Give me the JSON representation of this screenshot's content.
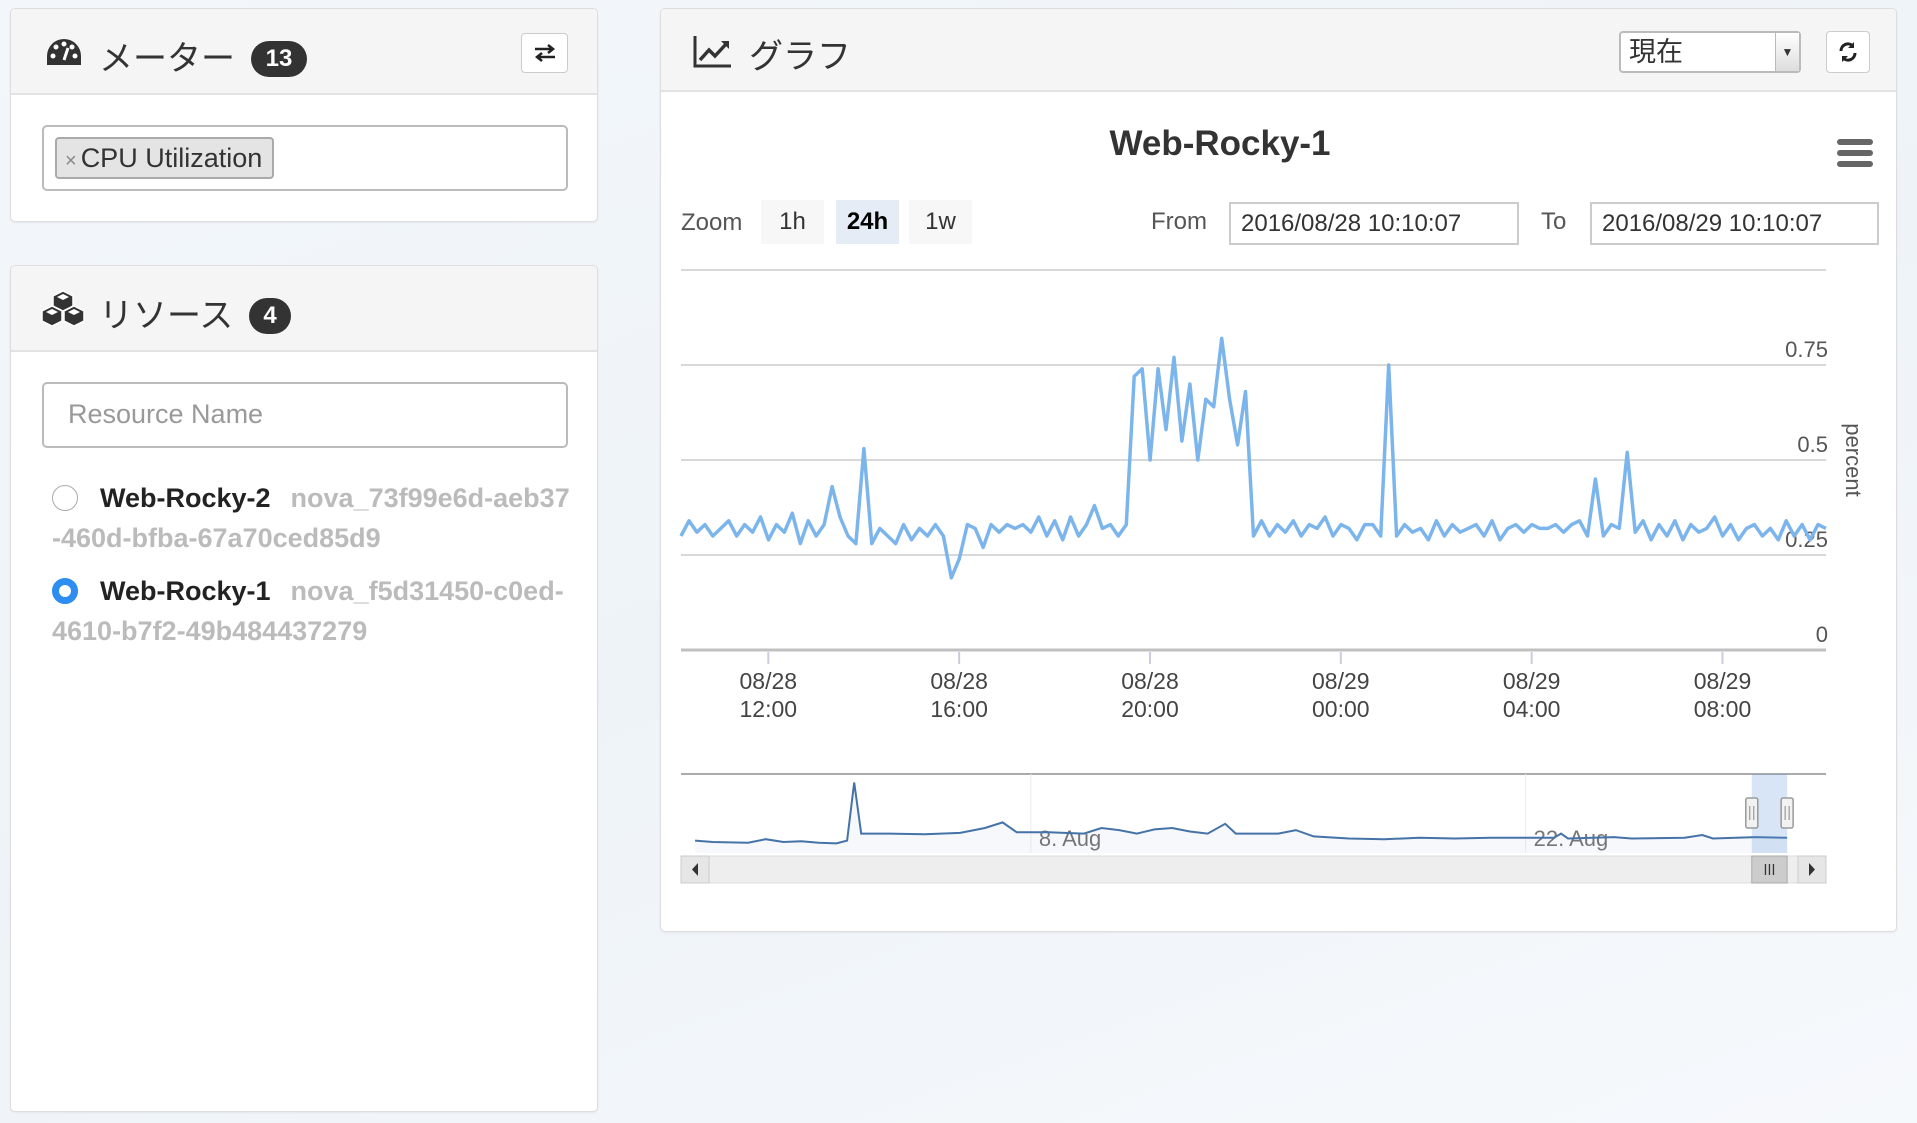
{
  "meters": {
    "title": "メーター",
    "count": "13",
    "selected_tag": "CPU Utilization",
    "tag_remove": "×"
  },
  "resources": {
    "title": "リソース",
    "count": "4",
    "search_placeholder": "Resource Name",
    "items": [
      {
        "name": "Web-Rocky-2",
        "id": "nova_73f99e6d-aeb37-460d-bfba-67a70ced85d9",
        "selected": false
      },
      {
        "name": "Web-Rocky-1",
        "id": "nova_f5d31450-c0ed-4610-b7f2-49b484437279",
        "selected": true
      }
    ]
  },
  "graph": {
    "title": "グラフ",
    "period_select": "現在",
    "zoom_label": "Zoom",
    "zoom_options": [
      "1h",
      "24h",
      "1w"
    ],
    "zoom_selected": "24h",
    "from_label": "From",
    "from_value": "2016/08/28 10:10:07",
    "to_label": "To",
    "to_value": "2016/08/29 10:10:07"
  },
  "colors": {
    "series": "#7cb5ec",
    "navigator": "#4572a7",
    "selected_radio": "#2e8df0"
  },
  "chart_data": {
    "type": "line",
    "title": "Web-Rocky-1",
    "ylabel": "percent",
    "ylim": [
      0,
      1
    ],
    "yticks": [
      "0",
      "0.25",
      "0.5",
      "0.75"
    ],
    "ytick_values": [
      0,
      0.25,
      0.5,
      0.75
    ],
    "x_start": "2016/08/28 10:10:07",
    "x_end": "2016/08/29 10:10:07",
    "x_step_minutes": 10,
    "xticks": [
      {
        "l1": "08/28",
        "l2": "12:00",
        "hours": 1.83
      },
      {
        "l1": "08/28",
        "l2": "16:00",
        "hours": 5.83
      },
      {
        "l1": "08/28",
        "l2": "20:00",
        "hours": 9.83
      },
      {
        "l1": "08/29",
        "l2": "00:00",
        "hours": 13.83
      },
      {
        "l1": "08/29",
        "l2": "04:00",
        "hours": 17.83
      },
      {
        "l1": "08/29",
        "l2": "08:00",
        "hours": 21.83
      }
    ],
    "series": [
      {
        "name": "CPU Utilization",
        "values": [
          0.3,
          0.34,
          0.31,
          0.33,
          0.3,
          0.32,
          0.34,
          0.3,
          0.33,
          0.31,
          0.35,
          0.29,
          0.33,
          0.31,
          0.36,
          0.28,
          0.34,
          0.3,
          0.33,
          0.43,
          0.35,
          0.3,
          0.28,
          0.53,
          0.28,
          0.32,
          0.3,
          0.28,
          0.33,
          0.29,
          0.32,
          0.3,
          0.33,
          0.3,
          0.19,
          0.24,
          0.33,
          0.32,
          0.27,
          0.33,
          0.31,
          0.33,
          0.32,
          0.33,
          0.31,
          0.35,
          0.3,
          0.34,
          0.29,
          0.35,
          0.3,
          0.33,
          0.38,
          0.32,
          0.33,
          0.3,
          0.33,
          0.72,
          0.74,
          0.5,
          0.74,
          0.58,
          0.77,
          0.55,
          0.7,
          0.5,
          0.66,
          0.64,
          0.82,
          0.66,
          0.54,
          0.68,
          0.3,
          0.34,
          0.3,
          0.33,
          0.31,
          0.34,
          0.3,
          0.33,
          0.32,
          0.35,
          0.3,
          0.33,
          0.32,
          0.29,
          0.33,
          0.33,
          0.3,
          0.75,
          0.3,
          0.33,
          0.31,
          0.32,
          0.29,
          0.34,
          0.3,
          0.33,
          0.31,
          0.32,
          0.33,
          0.3,
          0.34,
          0.29,
          0.32,
          0.33,
          0.31,
          0.33,
          0.32,
          0.32,
          0.33,
          0.31,
          0.33,
          0.34,
          0.3,
          0.45,
          0.3,
          0.33,
          0.32,
          0.52,
          0.31,
          0.34,
          0.29,
          0.33,
          0.3,
          0.34,
          0.29,
          0.33,
          0.31,
          0.32,
          0.35,
          0.3,
          0.33,
          0.29,
          0.32,
          0.33,
          0.3,
          0.32,
          0.29,
          0.34,
          0.3,
          0.33,
          0.29,
          0.33,
          0.32
        ]
      }
    ],
    "navigator": {
      "labels": [
        {
          "text": "8. Aug",
          "day": 8
        },
        {
          "text": "22. Aug",
          "day": 22
        }
      ],
      "day_range": [
        -1.9,
        30.5
      ],
      "selection_days": [
        28.4,
        29.4
      ],
      "points": [
        [
          -1.5,
          0.12
        ],
        [
          -1,
          0.1
        ],
        [
          0,
          0.09
        ],
        [
          0.5,
          0.14
        ],
        [
          1,
          0.1
        ],
        [
          1.5,
          0.11
        ],
        [
          2,
          0.09
        ],
        [
          2.5,
          0.08
        ],
        [
          2.8,
          0.12
        ],
        [
          3.0,
          0.95
        ],
        [
          3.2,
          0.22
        ],
        [
          4,
          0.22
        ],
        [
          5,
          0.21
        ],
        [
          6,
          0.23
        ],
        [
          6.7,
          0.3
        ],
        [
          7.2,
          0.38
        ],
        [
          7.6,
          0.24
        ],
        [
          8.5,
          0.24
        ],
        [
          9.5,
          0.22
        ],
        [
          10,
          0.3
        ],
        [
          10.5,
          0.27
        ],
        [
          11,
          0.22
        ],
        [
          11.5,
          0.28
        ],
        [
          12,
          0.3
        ],
        [
          12.5,
          0.25
        ],
        [
          13,
          0.22
        ],
        [
          13.5,
          0.36
        ],
        [
          13.8,
          0.22
        ],
        [
          15,
          0.22
        ],
        [
          15.5,
          0.27
        ],
        [
          16,
          0.18
        ],
        [
          17,
          0.15
        ],
        [
          18,
          0.14
        ],
        [
          19,
          0.16
        ],
        [
          20,
          0.15
        ],
        [
          21,
          0.16
        ],
        [
          22,
          0.16
        ],
        [
          22.8,
          0.16
        ],
        [
          23,
          0.22
        ],
        [
          23.2,
          0.15
        ],
        [
          24.5,
          0.17
        ],
        [
          25,
          0.15
        ],
        [
          26.5,
          0.16
        ],
        [
          27,
          0.2
        ],
        [
          27.3,
          0.15
        ],
        [
          28.5,
          0.17
        ],
        [
          29.4,
          0.16
        ]
      ]
    }
  }
}
